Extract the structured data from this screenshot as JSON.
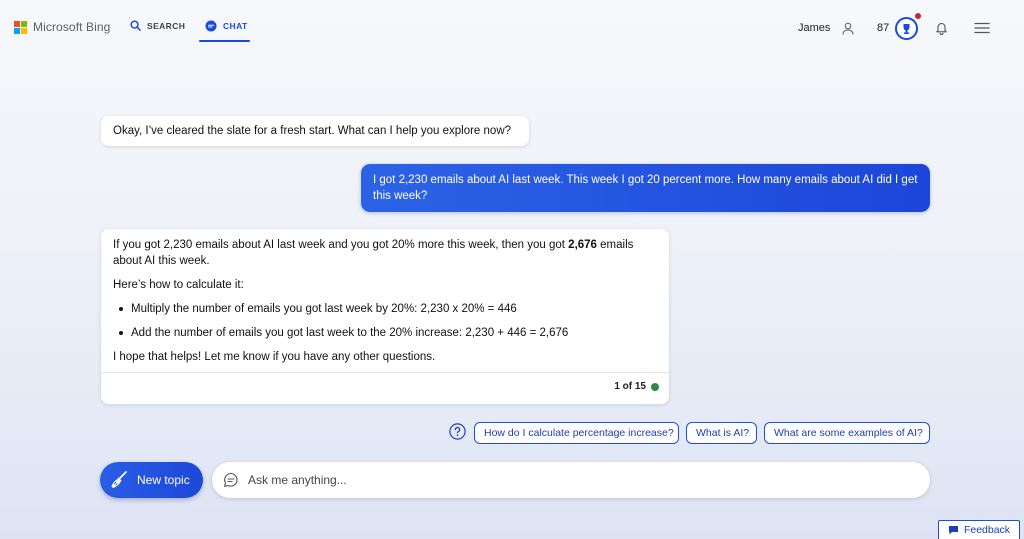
{
  "header": {
    "brand": "Microsoft Bing",
    "tabs": [
      {
        "label": "SEARCH",
        "icon": "search-icon",
        "active": false
      },
      {
        "label": "CHAT",
        "icon": "chat-icon",
        "active": true
      }
    ],
    "user_name": "James",
    "points": "87",
    "colors": {
      "accent": "#174ae4",
      "notification": "#c4262e"
    }
  },
  "conversation": {
    "bot_greeting": "Okay, I’ve cleared the slate for a fresh start. What can I help you explore now?",
    "user_message": "I got 2,230 emails about AI last week. This week I got 20 percent more. How many emails about AI did I get this week?",
    "answer": {
      "intro_before": "If you got 2,230 emails about AI last week and you got 20% more this week, then you got ",
      "intro_bold": "2,676",
      "intro_after": " emails about AI this week.",
      "how_to": "Here’s how to calculate it:",
      "steps": [
        "Multiply the number of emails you got last week by 20%: 2,230 x 20% = 446",
        "Add the number of emails you got last week to the 20% increase: 2,230 + 446 = 2,676"
      ],
      "closing": "I hope that helps! Let me know if you have any other questions.",
      "counter": "1 of 15"
    }
  },
  "suggestions": [
    "How do I calculate percentage increase?",
    "What is AI?",
    "What are some examples of AI?"
  ],
  "composer": {
    "new_topic_label": "New topic",
    "placeholder": "Ask me anything..."
  },
  "feedback_label": "Feedback"
}
